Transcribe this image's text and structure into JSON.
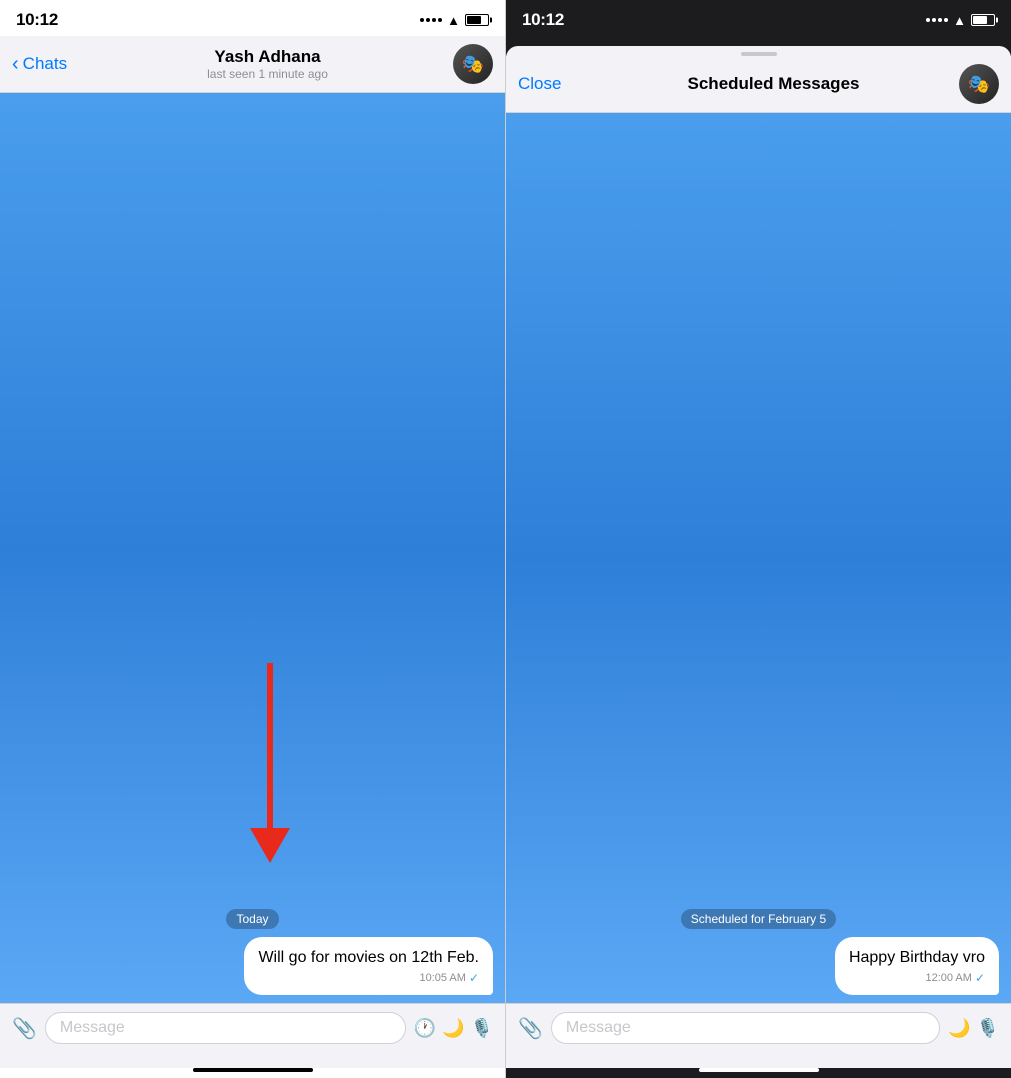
{
  "left_phone": {
    "status_bar": {
      "time": "10:12"
    },
    "nav": {
      "back_label": "Chats",
      "contact_name": "Yash Adhana",
      "last_seen": "last seen 1 minute ago"
    },
    "chat": {
      "date_label": "Today",
      "message_text": "Will go for movies on 12th Feb.",
      "message_time": "10:05 AM",
      "message_check": "✓"
    },
    "input_bar": {
      "placeholder": "Message"
    }
  },
  "right_phone": {
    "status_bar": {
      "time": "10:12"
    },
    "nav": {
      "close_label": "Close",
      "title": "Scheduled Messages"
    },
    "chat": {
      "scheduled_label": "Scheduled for February 5",
      "message_text": "Happy Birthday vro",
      "message_time": "12:00 AM",
      "message_check": "✓"
    },
    "input_bar": {
      "placeholder": "Message"
    }
  }
}
